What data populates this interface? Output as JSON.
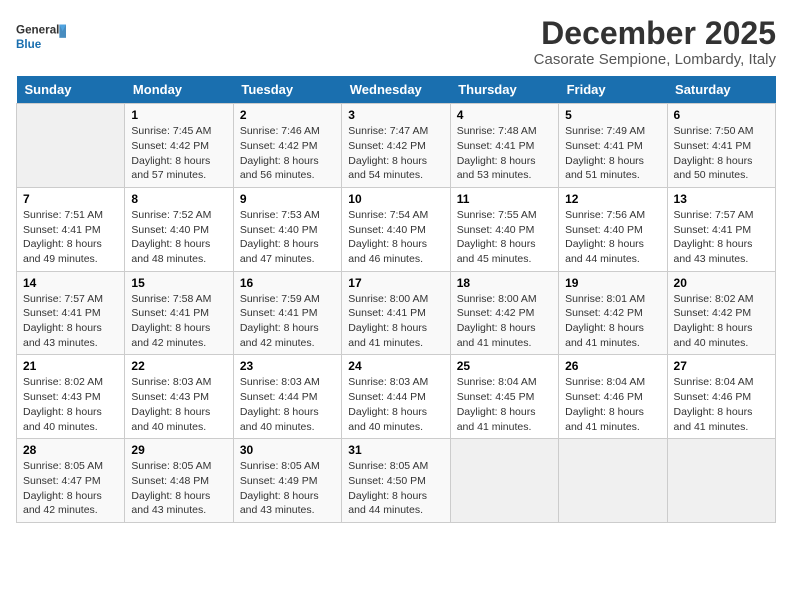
{
  "logo": {
    "text_general": "General",
    "text_blue": "Blue"
  },
  "title": "December 2025",
  "subtitle": "Casorate Sempione, Lombardy, Italy",
  "header_color": "#1a6faf",
  "days_of_week": [
    "Sunday",
    "Monday",
    "Tuesday",
    "Wednesday",
    "Thursday",
    "Friday",
    "Saturday"
  ],
  "weeks": [
    [
      {
        "day": "",
        "sunrise": "",
        "sunset": "",
        "daylight": ""
      },
      {
        "day": "1",
        "sunrise": "Sunrise: 7:45 AM",
        "sunset": "Sunset: 4:42 PM",
        "daylight": "Daylight: 8 hours and 57 minutes."
      },
      {
        "day": "2",
        "sunrise": "Sunrise: 7:46 AM",
        "sunset": "Sunset: 4:42 PM",
        "daylight": "Daylight: 8 hours and 56 minutes."
      },
      {
        "day": "3",
        "sunrise": "Sunrise: 7:47 AM",
        "sunset": "Sunset: 4:42 PM",
        "daylight": "Daylight: 8 hours and 54 minutes."
      },
      {
        "day": "4",
        "sunrise": "Sunrise: 7:48 AM",
        "sunset": "Sunset: 4:41 PM",
        "daylight": "Daylight: 8 hours and 53 minutes."
      },
      {
        "day": "5",
        "sunrise": "Sunrise: 7:49 AM",
        "sunset": "Sunset: 4:41 PM",
        "daylight": "Daylight: 8 hours and 51 minutes."
      },
      {
        "day": "6",
        "sunrise": "Sunrise: 7:50 AM",
        "sunset": "Sunset: 4:41 PM",
        "daylight": "Daylight: 8 hours and 50 minutes."
      }
    ],
    [
      {
        "day": "7",
        "sunrise": "Sunrise: 7:51 AM",
        "sunset": "Sunset: 4:41 PM",
        "daylight": "Daylight: 8 hours and 49 minutes."
      },
      {
        "day": "8",
        "sunrise": "Sunrise: 7:52 AM",
        "sunset": "Sunset: 4:40 PM",
        "daylight": "Daylight: 8 hours and 48 minutes."
      },
      {
        "day": "9",
        "sunrise": "Sunrise: 7:53 AM",
        "sunset": "Sunset: 4:40 PM",
        "daylight": "Daylight: 8 hours and 47 minutes."
      },
      {
        "day": "10",
        "sunrise": "Sunrise: 7:54 AM",
        "sunset": "Sunset: 4:40 PM",
        "daylight": "Daylight: 8 hours and 46 minutes."
      },
      {
        "day": "11",
        "sunrise": "Sunrise: 7:55 AM",
        "sunset": "Sunset: 4:40 PM",
        "daylight": "Daylight: 8 hours and 45 minutes."
      },
      {
        "day": "12",
        "sunrise": "Sunrise: 7:56 AM",
        "sunset": "Sunset: 4:40 PM",
        "daylight": "Daylight: 8 hours and 44 minutes."
      },
      {
        "day": "13",
        "sunrise": "Sunrise: 7:57 AM",
        "sunset": "Sunset: 4:41 PM",
        "daylight": "Daylight: 8 hours and 43 minutes."
      }
    ],
    [
      {
        "day": "14",
        "sunrise": "Sunrise: 7:57 AM",
        "sunset": "Sunset: 4:41 PM",
        "daylight": "Daylight: 8 hours and 43 minutes."
      },
      {
        "day": "15",
        "sunrise": "Sunrise: 7:58 AM",
        "sunset": "Sunset: 4:41 PM",
        "daylight": "Daylight: 8 hours and 42 minutes."
      },
      {
        "day": "16",
        "sunrise": "Sunrise: 7:59 AM",
        "sunset": "Sunset: 4:41 PM",
        "daylight": "Daylight: 8 hours and 42 minutes."
      },
      {
        "day": "17",
        "sunrise": "Sunrise: 8:00 AM",
        "sunset": "Sunset: 4:41 PM",
        "daylight": "Daylight: 8 hours and 41 minutes."
      },
      {
        "day": "18",
        "sunrise": "Sunrise: 8:00 AM",
        "sunset": "Sunset: 4:42 PM",
        "daylight": "Daylight: 8 hours and 41 minutes."
      },
      {
        "day": "19",
        "sunrise": "Sunrise: 8:01 AM",
        "sunset": "Sunset: 4:42 PM",
        "daylight": "Daylight: 8 hours and 41 minutes."
      },
      {
        "day": "20",
        "sunrise": "Sunrise: 8:02 AM",
        "sunset": "Sunset: 4:42 PM",
        "daylight": "Daylight: 8 hours and 40 minutes."
      }
    ],
    [
      {
        "day": "21",
        "sunrise": "Sunrise: 8:02 AM",
        "sunset": "Sunset: 4:43 PM",
        "daylight": "Daylight: 8 hours and 40 minutes."
      },
      {
        "day": "22",
        "sunrise": "Sunrise: 8:03 AM",
        "sunset": "Sunset: 4:43 PM",
        "daylight": "Daylight: 8 hours and 40 minutes."
      },
      {
        "day": "23",
        "sunrise": "Sunrise: 8:03 AM",
        "sunset": "Sunset: 4:44 PM",
        "daylight": "Daylight: 8 hours and 40 minutes."
      },
      {
        "day": "24",
        "sunrise": "Sunrise: 8:03 AM",
        "sunset": "Sunset: 4:44 PM",
        "daylight": "Daylight: 8 hours and 40 minutes."
      },
      {
        "day": "25",
        "sunrise": "Sunrise: 8:04 AM",
        "sunset": "Sunset: 4:45 PM",
        "daylight": "Daylight: 8 hours and 41 minutes."
      },
      {
        "day": "26",
        "sunrise": "Sunrise: 8:04 AM",
        "sunset": "Sunset: 4:46 PM",
        "daylight": "Daylight: 8 hours and 41 minutes."
      },
      {
        "day": "27",
        "sunrise": "Sunrise: 8:04 AM",
        "sunset": "Sunset: 4:46 PM",
        "daylight": "Daylight: 8 hours and 41 minutes."
      }
    ],
    [
      {
        "day": "28",
        "sunrise": "Sunrise: 8:05 AM",
        "sunset": "Sunset: 4:47 PM",
        "daylight": "Daylight: 8 hours and 42 minutes."
      },
      {
        "day": "29",
        "sunrise": "Sunrise: 8:05 AM",
        "sunset": "Sunset: 4:48 PM",
        "daylight": "Daylight: 8 hours and 43 minutes."
      },
      {
        "day": "30",
        "sunrise": "Sunrise: 8:05 AM",
        "sunset": "Sunset: 4:49 PM",
        "daylight": "Daylight: 8 hours and 43 minutes."
      },
      {
        "day": "31",
        "sunrise": "Sunrise: 8:05 AM",
        "sunset": "Sunset: 4:50 PM",
        "daylight": "Daylight: 8 hours and 44 minutes."
      },
      {
        "day": "",
        "sunrise": "",
        "sunset": "",
        "daylight": ""
      },
      {
        "day": "",
        "sunrise": "",
        "sunset": "",
        "daylight": ""
      },
      {
        "day": "",
        "sunrise": "",
        "sunset": "",
        "daylight": ""
      }
    ]
  ]
}
